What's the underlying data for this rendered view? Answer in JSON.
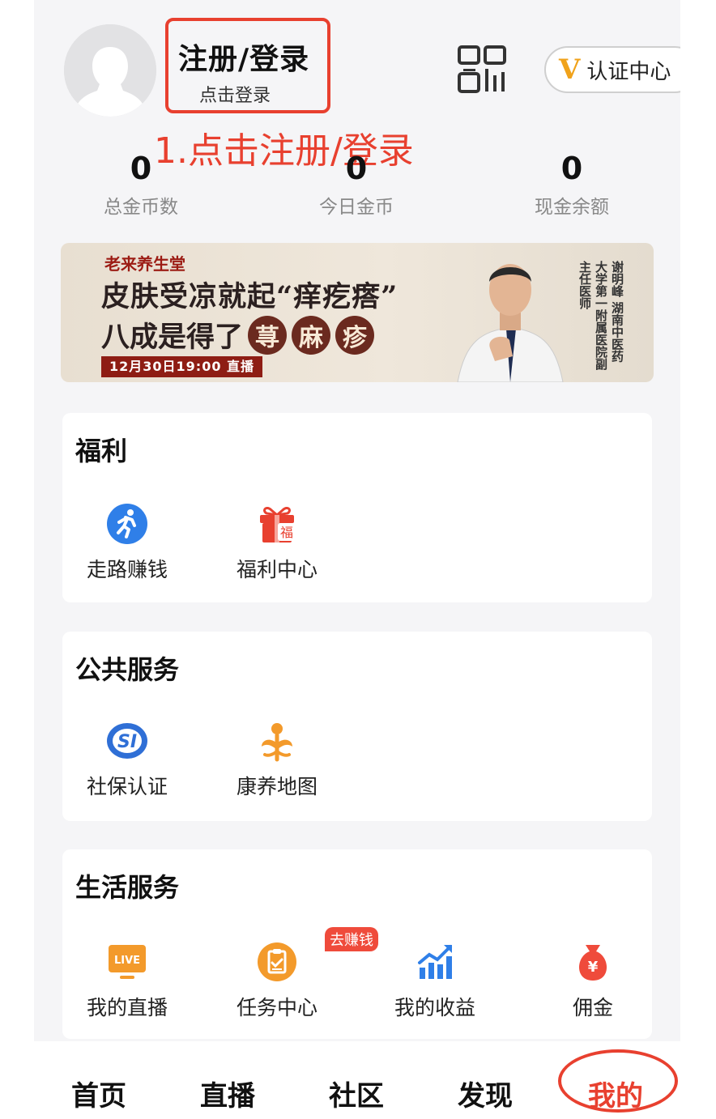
{
  "header": {
    "login_title": "注册/登录",
    "login_sub": "点击登录",
    "annotation": "1.点击注册/登录",
    "verify_v": "V",
    "verify_label": "认证中心"
  },
  "stats": [
    {
      "value": "0",
      "label": "总金币数"
    },
    {
      "value": "0",
      "label": "今日金币"
    },
    {
      "value": "0",
      "label": "现金余额"
    }
  ],
  "banner": {
    "brand": "老来养生堂",
    "line1": "皮肤受凉就起“痒疙瘩”",
    "line2_prefix": "八成是得了",
    "badges": [
      "荨",
      "麻",
      "疹"
    ],
    "date": "12月30日19:00 直播",
    "doctor": "谢明峰 湖南中医药大学第一附属医院副主任医师"
  },
  "sections": {
    "welfare": {
      "title": "福利",
      "items": [
        {
          "label": "走路赚钱",
          "icon": "running-icon"
        },
        {
          "label": "福利中心",
          "icon": "gift-icon",
          "icon_text": "福"
        }
      ]
    },
    "public": {
      "title": "公共服务",
      "items": [
        {
          "label": "社保认证",
          "icon": "social-security-icon",
          "icon_text": "SI"
        },
        {
          "label": "康养地图",
          "icon": "map-flower-icon"
        }
      ]
    },
    "life": {
      "title": "生活服务",
      "badge": "去赚钱",
      "items": [
        {
          "label": "我的直播",
          "icon": "live-tv-icon",
          "icon_text": "LIVE"
        },
        {
          "label": "任务中心",
          "icon": "task-clipboard-icon"
        },
        {
          "label": "我的收益",
          "icon": "earnings-chart-icon"
        },
        {
          "label": "佣金",
          "icon": "money-bag-icon",
          "icon_text": "¥"
        }
      ]
    }
  },
  "tabs": [
    "首页",
    "直播",
    "社区",
    "发现",
    "我的"
  ],
  "colors": {
    "accent_red": "#e8402f",
    "blue": "#2f7fe8",
    "orange": "#f39a2b",
    "tab_active": "#e8402f"
  }
}
